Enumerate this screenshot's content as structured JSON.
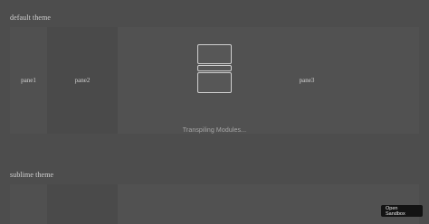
{
  "sections": [
    {
      "title": "default theme",
      "panes": [
        "pane1",
        "pane2",
        "pane3"
      ]
    },
    {
      "title": "sublime theme",
      "panes": [
        "",
        "",
        ""
      ]
    }
  ],
  "loading": {
    "text": "Transpiling Modules..."
  },
  "sandbox_button": {
    "line1": "Open",
    "line2": "Sandbox"
  }
}
